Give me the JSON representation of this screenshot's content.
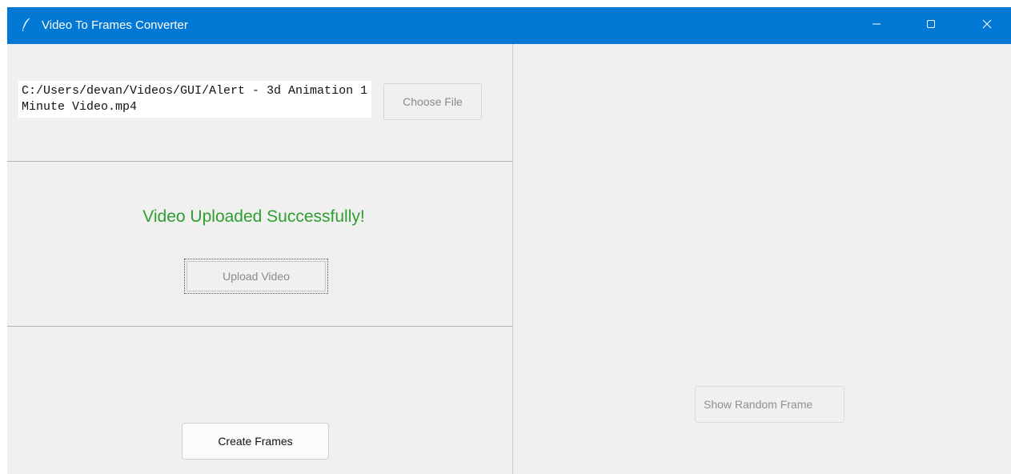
{
  "window": {
    "title": "Video To Frames Converter",
    "accent_color": "#0078d4",
    "controls": [
      "minimize-icon",
      "maximize-icon",
      "close-icon"
    ]
  },
  "file_picker": {
    "path_value": "C:/Users/devan/Videos/GUI/Alert - 3d Animation 1 Minute Video.mp4",
    "choose_label": "Choose File"
  },
  "upload": {
    "status_message": "Video Uploaded Successfully!",
    "status_color": "#2e9e2e",
    "upload_label": "Upload Video"
  },
  "actions": {
    "create_frames_label": "Create Frames",
    "show_random_frame_label": "Show Random Frame"
  }
}
